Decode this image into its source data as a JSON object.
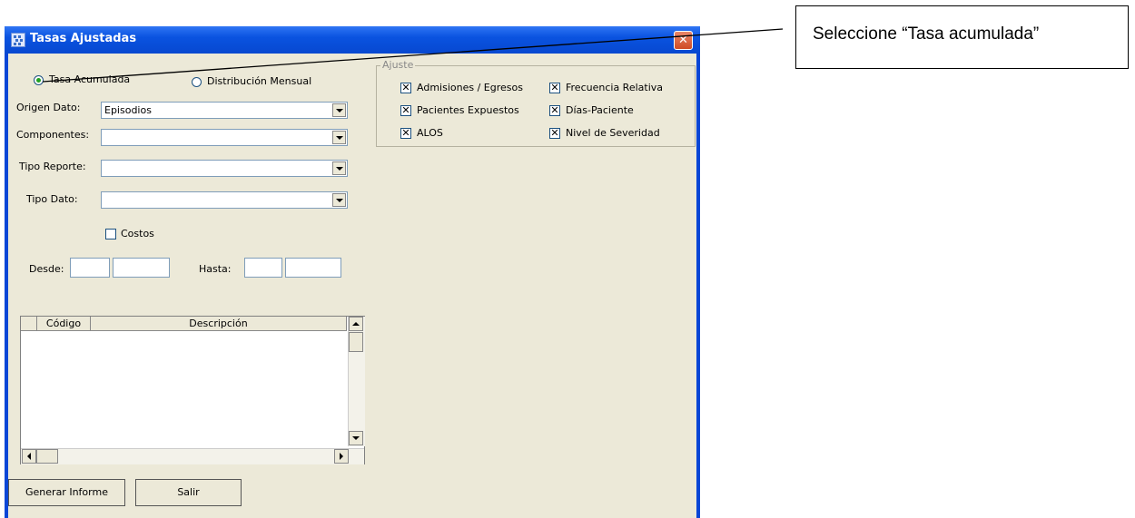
{
  "window": {
    "title": "Tasas Ajustadas",
    "close_glyph": "✕"
  },
  "mode": {
    "option_accumulated": "Tasa Acumulada",
    "option_monthly": "Distribución Mensual",
    "selected": "Tasa Acumulada"
  },
  "fields": {
    "origen_label": "Origen Dato:",
    "origen_value": "Episodios",
    "componentes_label": "Componentes:",
    "componentes_value": "",
    "tipo_reporte_label": "Tipo Reporte:",
    "tipo_reporte_value": "",
    "tipo_dato_label": "Tipo Dato:",
    "tipo_dato_value": "",
    "costos_label": "Costos",
    "costos_checked": false,
    "desde_label": "Desde:",
    "hasta_label": "Hasta:"
  },
  "ajuste": {
    "title": "Ajuste",
    "items": [
      {
        "label": "Admisiones / Egresos",
        "checked": true
      },
      {
        "label": "Frecuencia Relativa",
        "checked": true
      },
      {
        "label": "Pacientes Expuestos",
        "checked": true
      },
      {
        "label": "Días-Paciente",
        "checked": true
      },
      {
        "label": "ALOS",
        "checked": true
      },
      {
        "label": "Nivel de Severidad",
        "checked": true
      }
    ]
  },
  "grid": {
    "columns": [
      "Código",
      "Descripción"
    ],
    "rows": []
  },
  "buttons": {
    "generate": "Generar Informe",
    "exit": "Salir"
  },
  "callout": {
    "text": "Seleccione “Tasa acumulada”"
  },
  "icons": [
    "app-icon",
    "close-icon",
    "radio-icon",
    "checkbox-icon",
    "dropdown-arrow-icon",
    "scroll-up-icon",
    "scroll-down-icon",
    "scroll-left-icon",
    "scroll-right-icon"
  ]
}
